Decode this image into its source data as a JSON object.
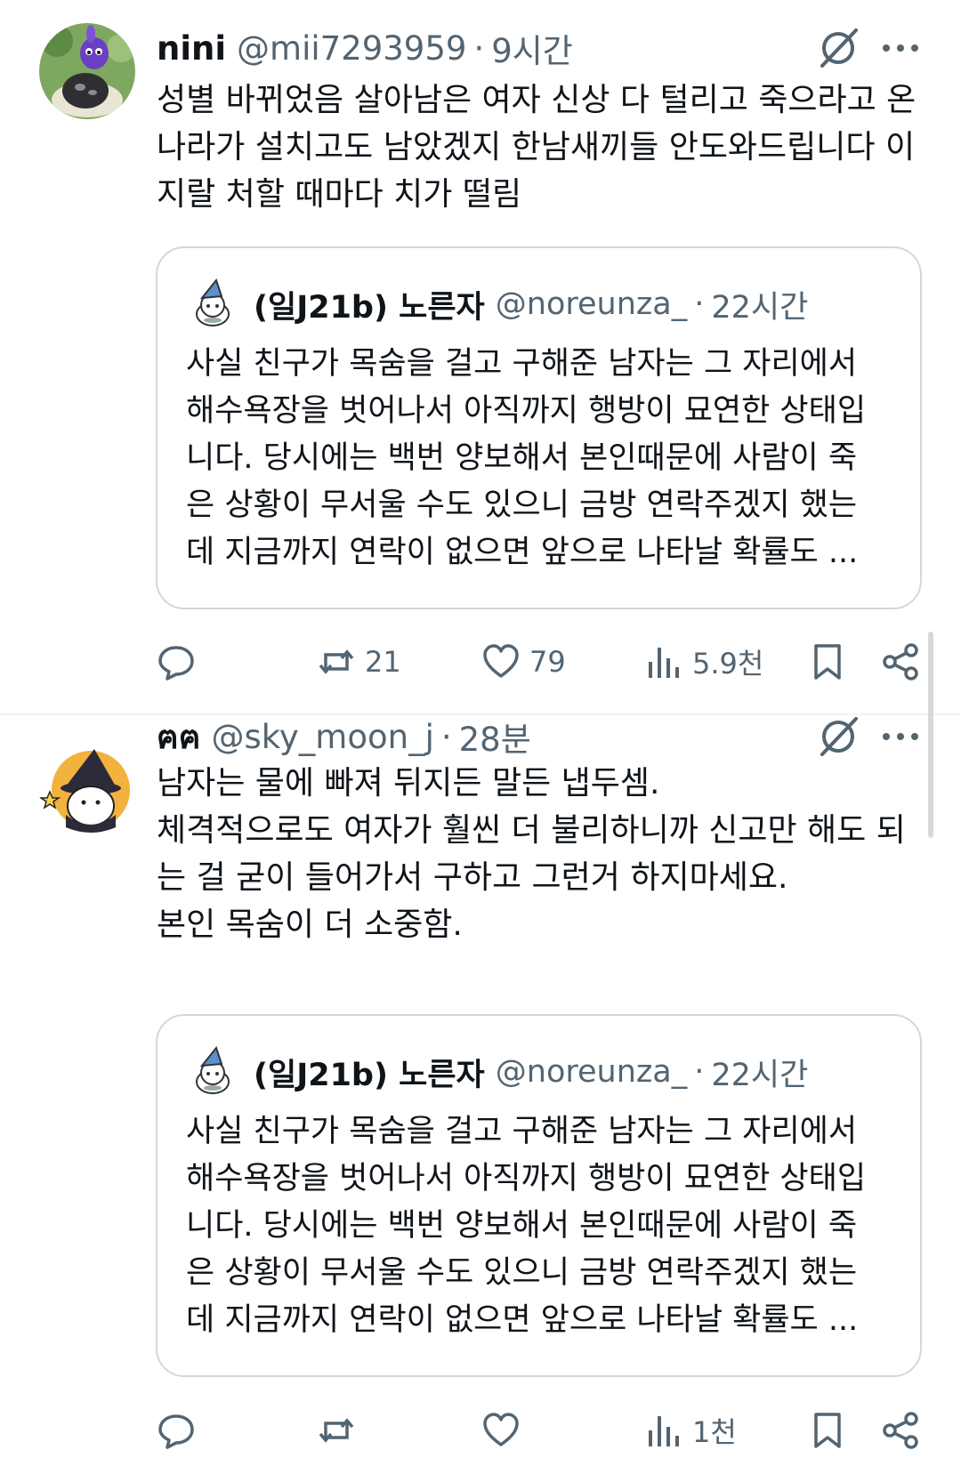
{
  "tweets": [
    {
      "author_name": "nini",
      "handle": "@mii7293959",
      "separator": "·",
      "time": "9시간",
      "avatar_icon": "purple-creature-avatar",
      "text_lines": [
        "성별 바뀌었음 살아남은 여자 신상 다 털리고 죽으라고 온",
        "나라가 설치고도 남았겠지 한남새끼들 안도와드립니다 이",
        "지랄 처할 때마다 치가 떨림"
      ],
      "quote": {
        "author_name": "(일J21b) 노른자",
        "handle": "@noreunza_",
        "separator": "·",
        "time": "22시간",
        "text_lines": [
          "사실 친구가 목숨을 걸고 구해준 남자는 그 자리에서",
          "해수욕장을 벗어나서 아직까지 행방이 묘연한 상태입",
          "니다. 당시에는 백번 양보해서 본인때문에 사람이 죽",
          "은 상황이 무서울 수도 있으니 금방 연락주겠지 했는",
          "데 지금까지 연락이 없으면 앞으로 나타날 확률도 ..."
        ]
      },
      "actions": {
        "replies": "",
        "retweets": "21",
        "likes": "79",
        "views": "5.9천"
      }
    },
    {
      "author_name": "ฅฅ",
      "handle": "@sky_moon_j",
      "separator": "·",
      "time": "28분",
      "avatar_icon": "witch-ghost-avatar",
      "text_lines": [
        "남자는 물에 빠져 뒤지든 말든 냅두셈.",
        "체격적으로도 여자가 훨씬 더 불리하니까  신고만 해도 되",
        "는 걸 굳이 들어가서 구하고 그런거 하지마세요.",
        "본인 목숨이 더 소중함."
      ],
      "quote": {
        "author_name": "(일J21b) 노른자",
        "handle": "@noreunza_",
        "separator": "·",
        "time": "22시간",
        "text_lines": [
          "사실 친구가 목숨을 걸고 구해준 남자는 그 자리에서",
          "해수욕장을 벗어나서 아직까지 행방이 묘연한 상태입",
          "니다. 당시에는 백번 양보해서 본인때문에 사람이 죽",
          "은 상황이 무서울 수도 있으니 금방 연락주겠지 했는",
          "데 지금까지 연락이 없으면 앞으로 나타날 확률도 ..."
        ]
      },
      "actions": {
        "replies": "",
        "retweets": "",
        "likes": "",
        "views": "1천"
      }
    }
  ],
  "colors": {
    "text": "#0f1419",
    "secondary": "#536471",
    "border": "#cfd9de"
  }
}
